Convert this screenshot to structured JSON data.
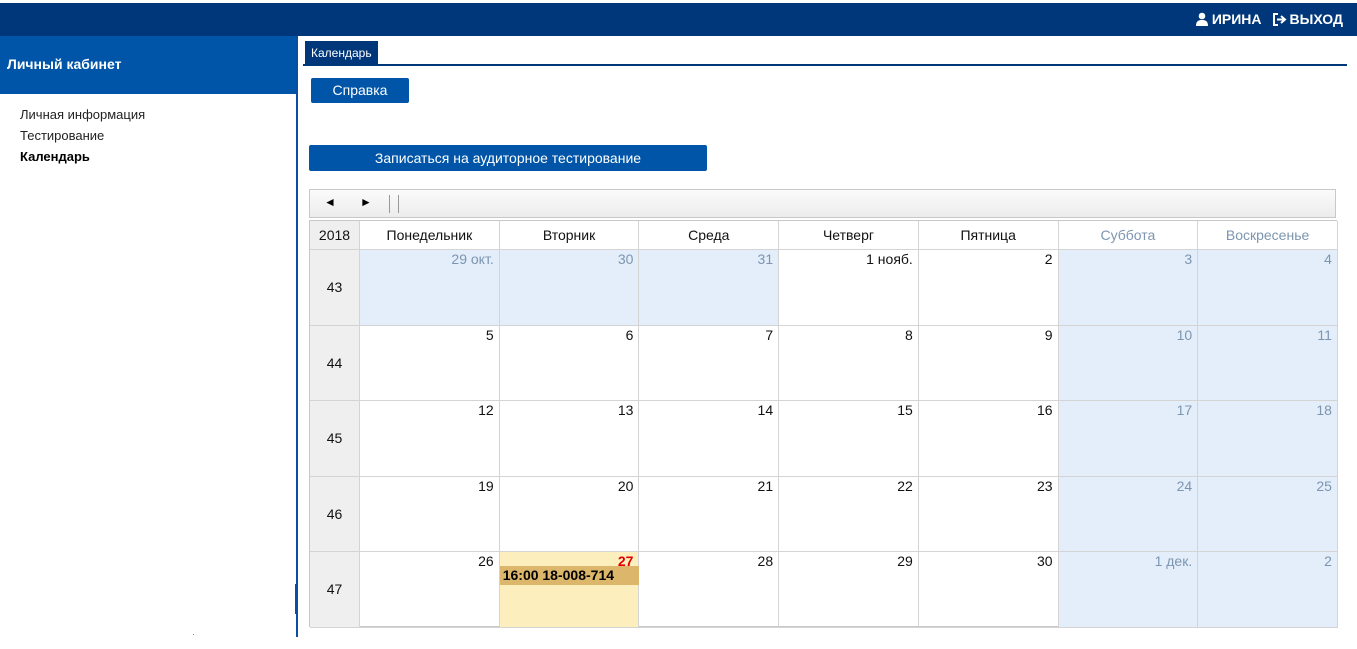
{
  "header": {
    "user_name": "ИРИНА",
    "logout_label": "ВЫХОД"
  },
  "sidebar": {
    "title": "Личный кабинет",
    "items": [
      {
        "label": "Личная информация",
        "active": false
      },
      {
        "label": "Тестирование",
        "active": false
      },
      {
        "label": "Календарь",
        "active": true
      }
    ]
  },
  "tabs": [
    {
      "label": "Календарь"
    }
  ],
  "buttons": {
    "help": "Справка",
    "register": "Записаться на аудиторное тестирование"
  },
  "calendar": {
    "nav": {
      "prev": "◄",
      "next": "►"
    },
    "year": "2018",
    "day_headers": [
      "Понедельник",
      "Вторник",
      "Среда",
      "Четверг",
      "Пятница",
      "Суббота",
      "Воскресенье"
    ],
    "weeks": [
      {
        "number": "43",
        "days": [
          {
            "label": "29 окт.",
            "other": true
          },
          {
            "label": "30",
            "other": true
          },
          {
            "label": "31",
            "other": true
          },
          {
            "label": "1 нояб."
          },
          {
            "label": "2"
          },
          {
            "label": "3",
            "weekend": true
          },
          {
            "label": "4",
            "weekend": true
          }
        ]
      },
      {
        "number": "44",
        "days": [
          {
            "label": "5"
          },
          {
            "label": "6"
          },
          {
            "label": "7"
          },
          {
            "label": "8"
          },
          {
            "label": "9"
          },
          {
            "label": "10",
            "weekend": true
          },
          {
            "label": "11",
            "weekend": true
          }
        ]
      },
      {
        "number": "45",
        "days": [
          {
            "label": "12"
          },
          {
            "label": "13"
          },
          {
            "label": "14"
          },
          {
            "label": "15"
          },
          {
            "label": "16"
          },
          {
            "label": "17",
            "weekend": true
          },
          {
            "label": "18",
            "weekend": true
          }
        ]
      },
      {
        "number": "46",
        "days": [
          {
            "label": "19"
          },
          {
            "label": "20"
          },
          {
            "label": "21"
          },
          {
            "label": "22"
          },
          {
            "label": "23"
          },
          {
            "label": "24",
            "weekend": true
          },
          {
            "label": "25",
            "weekend": true
          }
        ]
      },
      {
        "number": "47",
        "days": [
          {
            "label": "26"
          },
          {
            "label": "27",
            "today": true,
            "event": "16:00 18-008-714"
          },
          {
            "label": "28"
          },
          {
            "label": "29"
          },
          {
            "label": "30"
          },
          {
            "label": "1 дек.",
            "weekend": true
          },
          {
            "label": "2",
            "weekend": true
          }
        ]
      }
    ]
  },
  "colors": {
    "topbar": "#00377a",
    "sidebar_header": "#0055a8",
    "button": "#0055a8",
    "weekend_bg": "#e3eefa",
    "today_bg": "#fdeebd",
    "event_bg": "#dcb66a",
    "today_number": "#e00000"
  }
}
